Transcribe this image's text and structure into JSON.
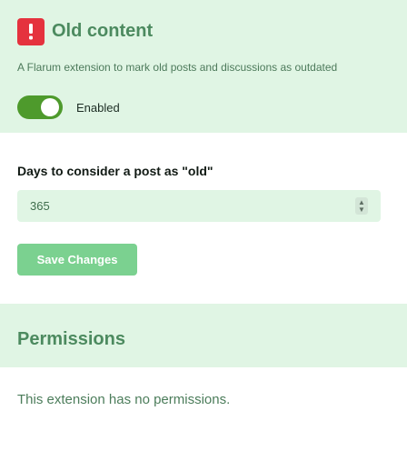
{
  "extension": {
    "title": "Old content",
    "description": "A Flarum extension to mark old posts and discussions as outdated",
    "icon": "exclamation-icon",
    "icon_color": "#e5323e",
    "enabled": true,
    "enabled_label": "Enabled"
  },
  "settings": {
    "days_label": "Days to consider a post as \"old\"",
    "days_value": "365",
    "save_label": "Save Changes"
  },
  "permissions": {
    "title": "Permissions",
    "empty_text": "This extension has no permissions."
  },
  "colors": {
    "accent": "#4c8a5f",
    "header_bg": "#e0f5e4",
    "toggle_on": "#4e9a2c",
    "button": "#7bd190"
  }
}
